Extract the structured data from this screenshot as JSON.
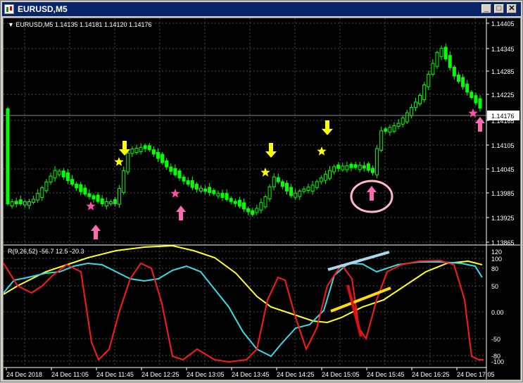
{
  "window": {
    "title": "EURUSD,M5"
  },
  "title_buttons": {
    "minimize": "_",
    "maximize": "□",
    "close": "✕"
  },
  "price_chart": {
    "header": "▼ EURUSD,M5  1.14135 1.14181 1.14120 1.14176",
    "current_price_label": "1.14176",
    "y_ticks": [
      "1.14405",
      "1.14345",
      "1.14285",
      "1.14225",
      "1.14165",
      "1.14105",
      "1.14045",
      "1.13985",
      "1.13925",
      "1.13865"
    ]
  },
  "indicator": {
    "header": "R(9,26,52) -56.7 12.5 -20.3",
    "y_ticks": [
      "120",
      "100",
      "80",
      "50",
      "0.00",
      "-50",
      "-80",
      "-100"
    ],
    "series_colors": {
      "fast": "#ff1a1a",
      "medium": "#33dde8",
      "slow": "#ffff22"
    }
  },
  "x_axis": {
    "ticks": [
      "24 Dec 2018",
      "24 Dec 11:05",
      "24 Dec 11:45",
      "24 Dec 12:25",
      "24 Dec 13:05",
      "24 Dec 13:45",
      "24 Dec 14:25",
      "24 Dec 15:05",
      "24 Dec 15:45",
      "24 Dec 16:25",
      "24 Dec 17:05"
    ]
  },
  "colors": {
    "candle": "#00ff00",
    "grid": "#4d4d4d",
    "star_buy": "#ff4fa6",
    "star_sell": "#ffff00",
    "arrow_buy": "#ff69b4",
    "arrow_sell": "#ffff00"
  },
  "icons": {
    "arrow_up": "pink-up-arrow-icon",
    "arrow_down": "yellow-down-arrow-icon",
    "star": "star-icon"
  }
}
